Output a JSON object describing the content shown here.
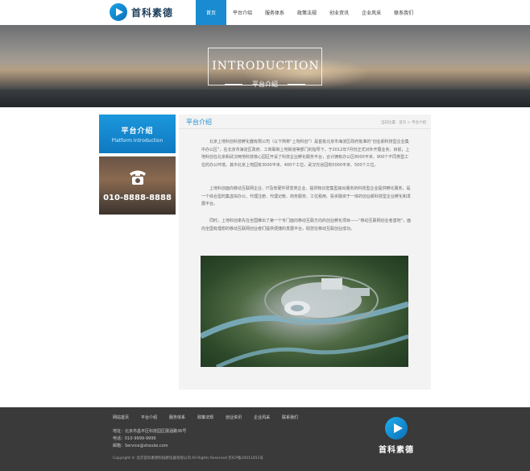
{
  "brand": {
    "logo_text": "首科素德"
  },
  "nav": {
    "items": [
      {
        "label": "首页",
        "active": true
      },
      {
        "label": "平台介绍",
        "active": false
      },
      {
        "label": "服务体系",
        "active": false
      },
      {
        "label": "政策法规",
        "active": false
      },
      {
        "label": "创业资讯",
        "active": false
      },
      {
        "label": "企业风采",
        "active": false
      },
      {
        "label": "联系我们",
        "active": false
      }
    ]
  },
  "banner": {
    "title": "INTRODUCTION",
    "subtitle": "平台介绍"
  },
  "sidebar": {
    "title_cn": "平台介绍",
    "title_en": "Platform Introduction",
    "phone_icon": "telephone-icon",
    "phone": "010-8888-8888"
  },
  "content": {
    "title": "平台介绍",
    "breadcrumb": "当前位置：首页 > 平台介绍",
    "paragraphs": [
      "北京上地科创科技孵化器有限公司（以下简称“上地科创”）是首批北京市海淀区政府批准的“创业颠科技型企业集中办公区”，在北京市海淀区政府、工商联和上地街道等部门的指导下，于2012年7月份正式对外开展业务。目前，上地科创在北京和武汉两地科技核心园区开设了科技企业孵化服务平台，合计拥有办公区8000平米、900个不同类型工位的办公环境。其中北京上地园有3000平米、400个工位，武汉光谷园有5000平米、500个工位。",
      "上地科创面向移动互联网企业、IT及软硬件研发类企业、提供知识密集型输出服务的科技型企业提供孵化服务，是一个综合型的集虚拟办公、代理注册、代理记帐、商务服务、工位租用、投资融资于一体的创业颠科技型企业孵化和发展平台。",
      "同时，上地科创率先在全国推出了第一个专门面向移动互联方向的创业孵化项目——“移动互联网创业者基地”，面向全国有理想的移动互联网创业者们提供便捷的发展平台，助您在移动互联创业成功。"
    ]
  },
  "footer": {
    "nav": [
      "网站首页",
      "平台介绍",
      "服务体系",
      "政策法规",
      "创业资讯",
      "企业风采",
      "联系我们"
    ],
    "address": "地址：北京市昌平区科技园区展涵路36号",
    "phone": "电话：010-9999-9999",
    "email": "邮箱：Service@shouke.com",
    "copyright": "Copyright © 北京首科素德科技孵化器有限公司 All Rights Reserved 京ICP备10011451号",
    "logo_text": "首科素德"
  },
  "colors": {
    "accent": "#1a8bd0",
    "footer_bg": "#3a3a3a",
    "panel_bg": "#f3f3f3"
  }
}
